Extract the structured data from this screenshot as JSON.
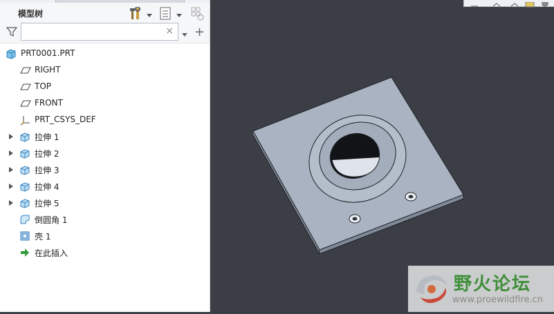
{
  "panel": {
    "title": "模型树",
    "search": {
      "value": "",
      "placeholder": ""
    },
    "clear_glyph": "×",
    "add_glyph": "+"
  },
  "tree": [
    {
      "label": "PRT0001.PRT",
      "icon": "part-icon",
      "expandable": false
    },
    {
      "label": "RIGHT",
      "icon": "datum-plane-icon",
      "expandable": false
    },
    {
      "label": "TOP",
      "icon": "datum-plane-icon",
      "expandable": false
    },
    {
      "label": "FRONT",
      "icon": "datum-plane-icon",
      "expandable": false
    },
    {
      "label": "PRT_CSYS_DEF",
      "icon": "coordinate-system-icon",
      "expandable": false
    },
    {
      "label": "拉伸 1",
      "icon": "extrude-icon",
      "expandable": true
    },
    {
      "label": "拉伸 2",
      "icon": "extrude-icon",
      "expandable": true
    },
    {
      "label": "拉伸 3",
      "icon": "extrude-icon",
      "expandable": true
    },
    {
      "label": "拉伸 4",
      "icon": "extrude-icon",
      "expandable": true
    },
    {
      "label": "拉伸 5",
      "icon": "extrude-icon",
      "expandable": true
    },
    {
      "label": "倒圆角 1",
      "icon": "round-icon",
      "expandable": false
    },
    {
      "label": "壳 1",
      "icon": "shell-icon",
      "expandable": false
    },
    {
      "label": "在此插入",
      "icon": "insert-here-arrow-icon",
      "expandable": false
    }
  ],
  "watermark": {
    "title": "野火论坛",
    "url": "www.proewildfire.cn",
    "logo_icon": "flame-swirl-logo"
  },
  "colors": {
    "viewport_bg": "#3b3e45",
    "model_face": "#a9b3c1",
    "accent_green": "#3f8f3a",
    "extrude_blue": "#5aa0d6"
  }
}
